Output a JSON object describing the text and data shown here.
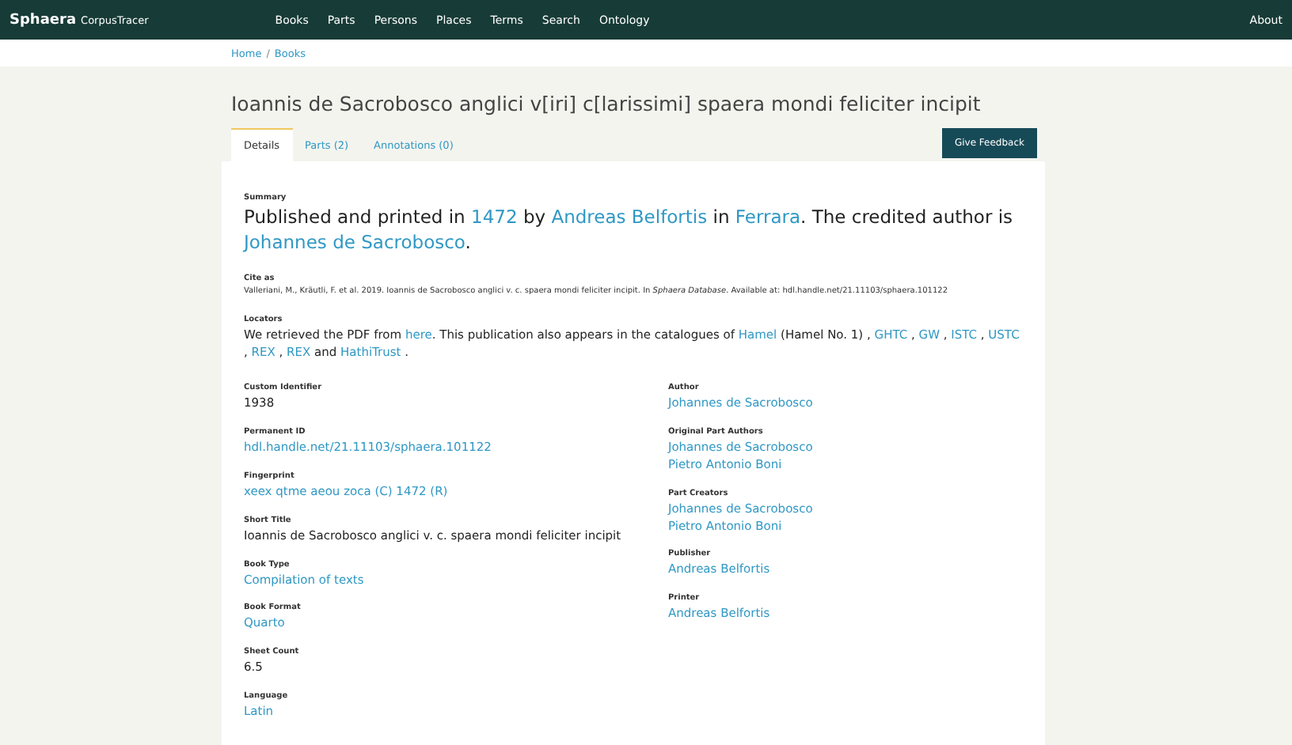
{
  "navbar": {
    "brand": "Sphaera",
    "brand_sub": "CorpusTracer",
    "items": [
      "Books",
      "Parts",
      "Persons",
      "Places",
      "Terms",
      "Search",
      "Ontology"
    ],
    "right": "About"
  },
  "breadcrumb": [
    "Home",
    "Books"
  ],
  "breadcrumb_separator": "/",
  "title": "Ioannis de Sacrobosco anglici v[iri] c[larissimi] spaera mondi feliciter incipit",
  "tabs": [
    {
      "label": "Details",
      "selected": true
    },
    {
      "label": "Parts (2)",
      "selected": false
    },
    {
      "label": "Annotations (0)",
      "selected": false
    }
  ],
  "feedback_button": "Give Feedback",
  "summary": {
    "label": "Summary",
    "parts": [
      {
        "text": "Published and printed in ",
        "link": false
      },
      {
        "text": "1472",
        "link": true
      },
      {
        "text": " by ",
        "link": false
      },
      {
        "text": "Andreas Belfortis",
        "link": true
      },
      {
        "text": " in ",
        "link": false
      },
      {
        "text": "Ferrara",
        "link": true
      },
      {
        "text": ". The credited author is ",
        "link": false
      },
      {
        "text": "Johannes de Sacrobosco",
        "link": true
      },
      {
        "text": ".",
        "link": false
      }
    ]
  },
  "cite": {
    "label": "Cite as",
    "text": "Valleriani, M., Kräutli, F. et al. 2019. Ioannis de Sacrobosco anglici v. c. spaera mondi feliciter incipit. In *Sphaera Database*. Available at: hdl.handle.net/21.11103/sphaera.101122"
  },
  "locators": {
    "label": "Locators",
    "parts": [
      {
        "text": "We retrieved the PDF from ",
        "link": false
      },
      {
        "text": "here",
        "link": true
      },
      {
        "text": ". This publication also appears in the catalogues of ",
        "link": false
      },
      {
        "text": "Hamel",
        "link": true
      },
      {
        "text": " (Hamel No. 1) , ",
        "link": false
      },
      {
        "text": "GHTC",
        "link": true
      },
      {
        "text": " , ",
        "link": false
      },
      {
        "text": "GW",
        "link": true
      },
      {
        "text": " , ",
        "link": false
      },
      {
        "text": "ISTC",
        "link": true
      },
      {
        "text": " , ",
        "link": false
      },
      {
        "text": "USTC",
        "link": true
      },
      {
        "text": " , ",
        "link": false
      },
      {
        "text": "REX",
        "link": true
      },
      {
        "text": " , ",
        "link": false
      },
      {
        "text": "REX",
        "link": true
      },
      {
        "text": " and ",
        "link": false
      },
      {
        "text": "HathiTrust",
        "link": true
      },
      {
        "text": " .",
        "link": false
      }
    ]
  },
  "left_fields": [
    {
      "label": "Custom Identifier",
      "values": [
        {
          "text": "1938",
          "link": false
        }
      ]
    },
    {
      "label": "Permanent ID",
      "values": [
        {
          "text": "hdl.handle.net/21.11103/sphaera.101122",
          "link": true
        }
      ]
    },
    {
      "label": "Fingerprint",
      "values": [
        {
          "text": "xeex qtme aeou zoca (C) 1472 (R)",
          "link": true
        }
      ]
    },
    {
      "label": "Short Title",
      "values": [
        {
          "text": "Ioannis de Sacrobosco anglici v. c. spaera mondi feliciter incipit",
          "link": false
        }
      ]
    },
    {
      "label": "Book Type",
      "values": [
        {
          "text": "Compilation of texts",
          "link": true
        }
      ]
    },
    {
      "label": "Book Format",
      "values": [
        {
          "text": "Quarto",
          "link": true
        }
      ]
    },
    {
      "label": "Sheet Count",
      "values": [
        {
          "text": "6.5",
          "link": false
        }
      ]
    },
    {
      "label": "Language",
      "values": [
        {
          "text": "Latin",
          "link": true
        }
      ]
    }
  ],
  "right_fields": [
    {
      "label": "Author",
      "values": [
        {
          "text": "Johannes de Sacrobosco",
          "link": true
        }
      ]
    },
    {
      "label": "Original Part Authors",
      "values": [
        {
          "text": "Johannes de Sacrobosco",
          "link": true
        },
        {
          "text": "Pietro Antonio Boni",
          "link": true
        }
      ]
    },
    {
      "label": "Part Creators",
      "values": [
        {
          "text": "Johannes de Sacrobosco",
          "link": true
        },
        {
          "text": "Pietro Antonio Boni",
          "link": true
        }
      ]
    },
    {
      "label": "Publisher",
      "values": [
        {
          "text": "Andreas Belfortis",
          "link": true
        }
      ]
    },
    {
      "label": "Printer",
      "values": [
        {
          "text": "Andreas Belfortis",
          "link": true
        }
      ]
    }
  ]
}
